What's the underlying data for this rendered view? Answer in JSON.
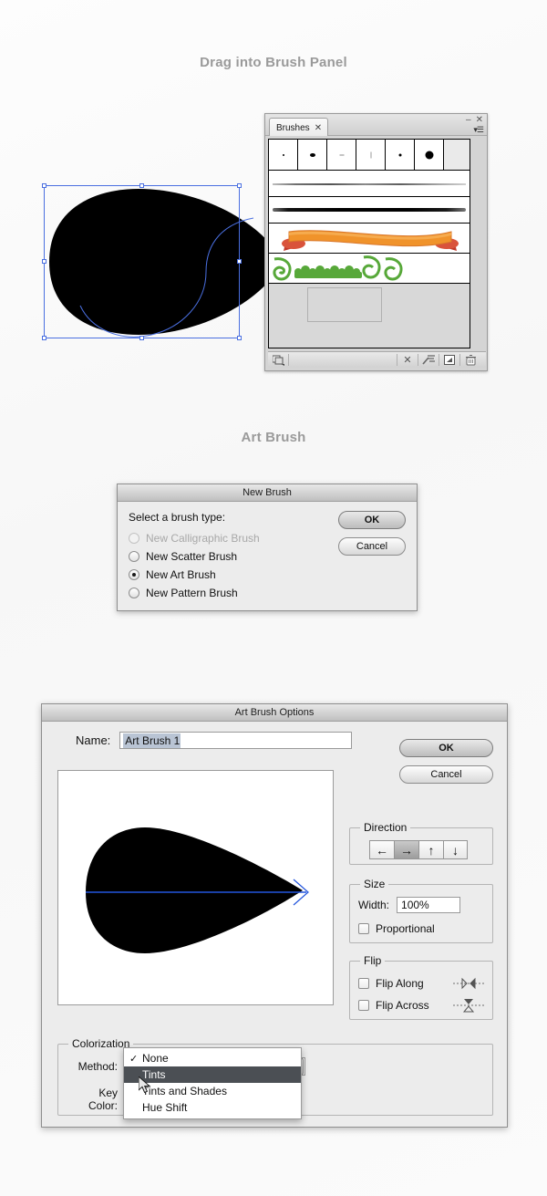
{
  "headings": {
    "drag": "Drag into Brush Panel",
    "art_brush": "Art Brush"
  },
  "brushes_panel": {
    "tab_label": "Brushes",
    "tab_close_icon": "close-icon",
    "minimize_icon": "minimize-icon",
    "close_icon": "close-icon",
    "menu_icon": "panel-menu-icon",
    "tips": [
      {
        "name": "brush-tip-1",
        "size": 2
      },
      {
        "name": "brush-tip-2",
        "size": 5
      },
      {
        "name": "brush-tip-3",
        "size": 3
      },
      {
        "name": "brush-tip-4",
        "size": 2
      },
      {
        "name": "brush-tip-5",
        "size": 4
      },
      {
        "name": "brush-tip-6",
        "size": 9
      }
    ],
    "strokes": [
      {
        "name": "thin-charcoal-stroke",
        "type": "art-brush"
      },
      {
        "name": "thick-charcoal-stroke",
        "type": "art-brush"
      },
      {
        "name": "orange-ribbon-brush",
        "type": "art-brush"
      },
      {
        "name": "green-floral-pattern-brush",
        "type": "pattern-brush"
      }
    ],
    "footer_icons": [
      "brush-libraries-icon",
      "remove-brush-stroke-icon",
      "brush-options-icon",
      "new-brush-icon",
      "delete-brush-icon"
    ]
  },
  "new_brush_dialog": {
    "title": "New Brush",
    "prompt": "Select a brush type:",
    "options": [
      {
        "label": "New Calligraphic Brush",
        "selected": false,
        "disabled": true
      },
      {
        "label": "New Scatter Brush",
        "selected": false,
        "disabled": false
      },
      {
        "label": "New Art Brush",
        "selected": true,
        "disabled": false
      },
      {
        "label": "New Pattern Brush",
        "selected": false,
        "disabled": false
      }
    ],
    "ok_label": "OK",
    "cancel_label": "Cancel"
  },
  "art_brush_options": {
    "title": "Art Brush Options",
    "name_label": "Name:",
    "name_value": "Art Brush 1",
    "ok_label": "OK",
    "cancel_label": "Cancel",
    "direction": {
      "legend": "Direction",
      "buttons": [
        {
          "name": "direction-left",
          "glyph": "←",
          "active": false
        },
        {
          "name": "direction-right",
          "glyph": "→",
          "active": true
        },
        {
          "name": "direction-up",
          "glyph": "↑",
          "active": false
        },
        {
          "name": "direction-down",
          "glyph": "↓",
          "active": false
        }
      ]
    },
    "size": {
      "legend": "Size",
      "width_label": "Width:",
      "width_value": "100%",
      "proportional_label": "Proportional",
      "proportional_checked": false
    },
    "flip": {
      "legend": "Flip",
      "flip_along_label": "Flip Along",
      "flip_along_checked": false,
      "flip_across_label": "Flip Across",
      "flip_across_checked": false
    },
    "colorization": {
      "legend": "Colorization",
      "method_label": "Method:",
      "method_value": "None",
      "key_color_label": "Key Color:",
      "key_color_hex": "#ffffff",
      "menu_options": [
        {
          "label": "None",
          "checked": true,
          "highlighted": false
        },
        {
          "label": "Tints",
          "checked": false,
          "highlighted": true
        },
        {
          "label": "Tints and Shades",
          "checked": false,
          "highlighted": false
        },
        {
          "label": "Hue Shift",
          "checked": false,
          "highlighted": false
        }
      ]
    }
  },
  "colors": {
    "heading_gray": "#9a9a9a",
    "dialog_bg": "#ececec",
    "menu_highlight": "#4b4f54",
    "selection_blue": "#4a6fe0",
    "ribbon_orange": "#f0932b",
    "floral_green": "#57a839"
  }
}
